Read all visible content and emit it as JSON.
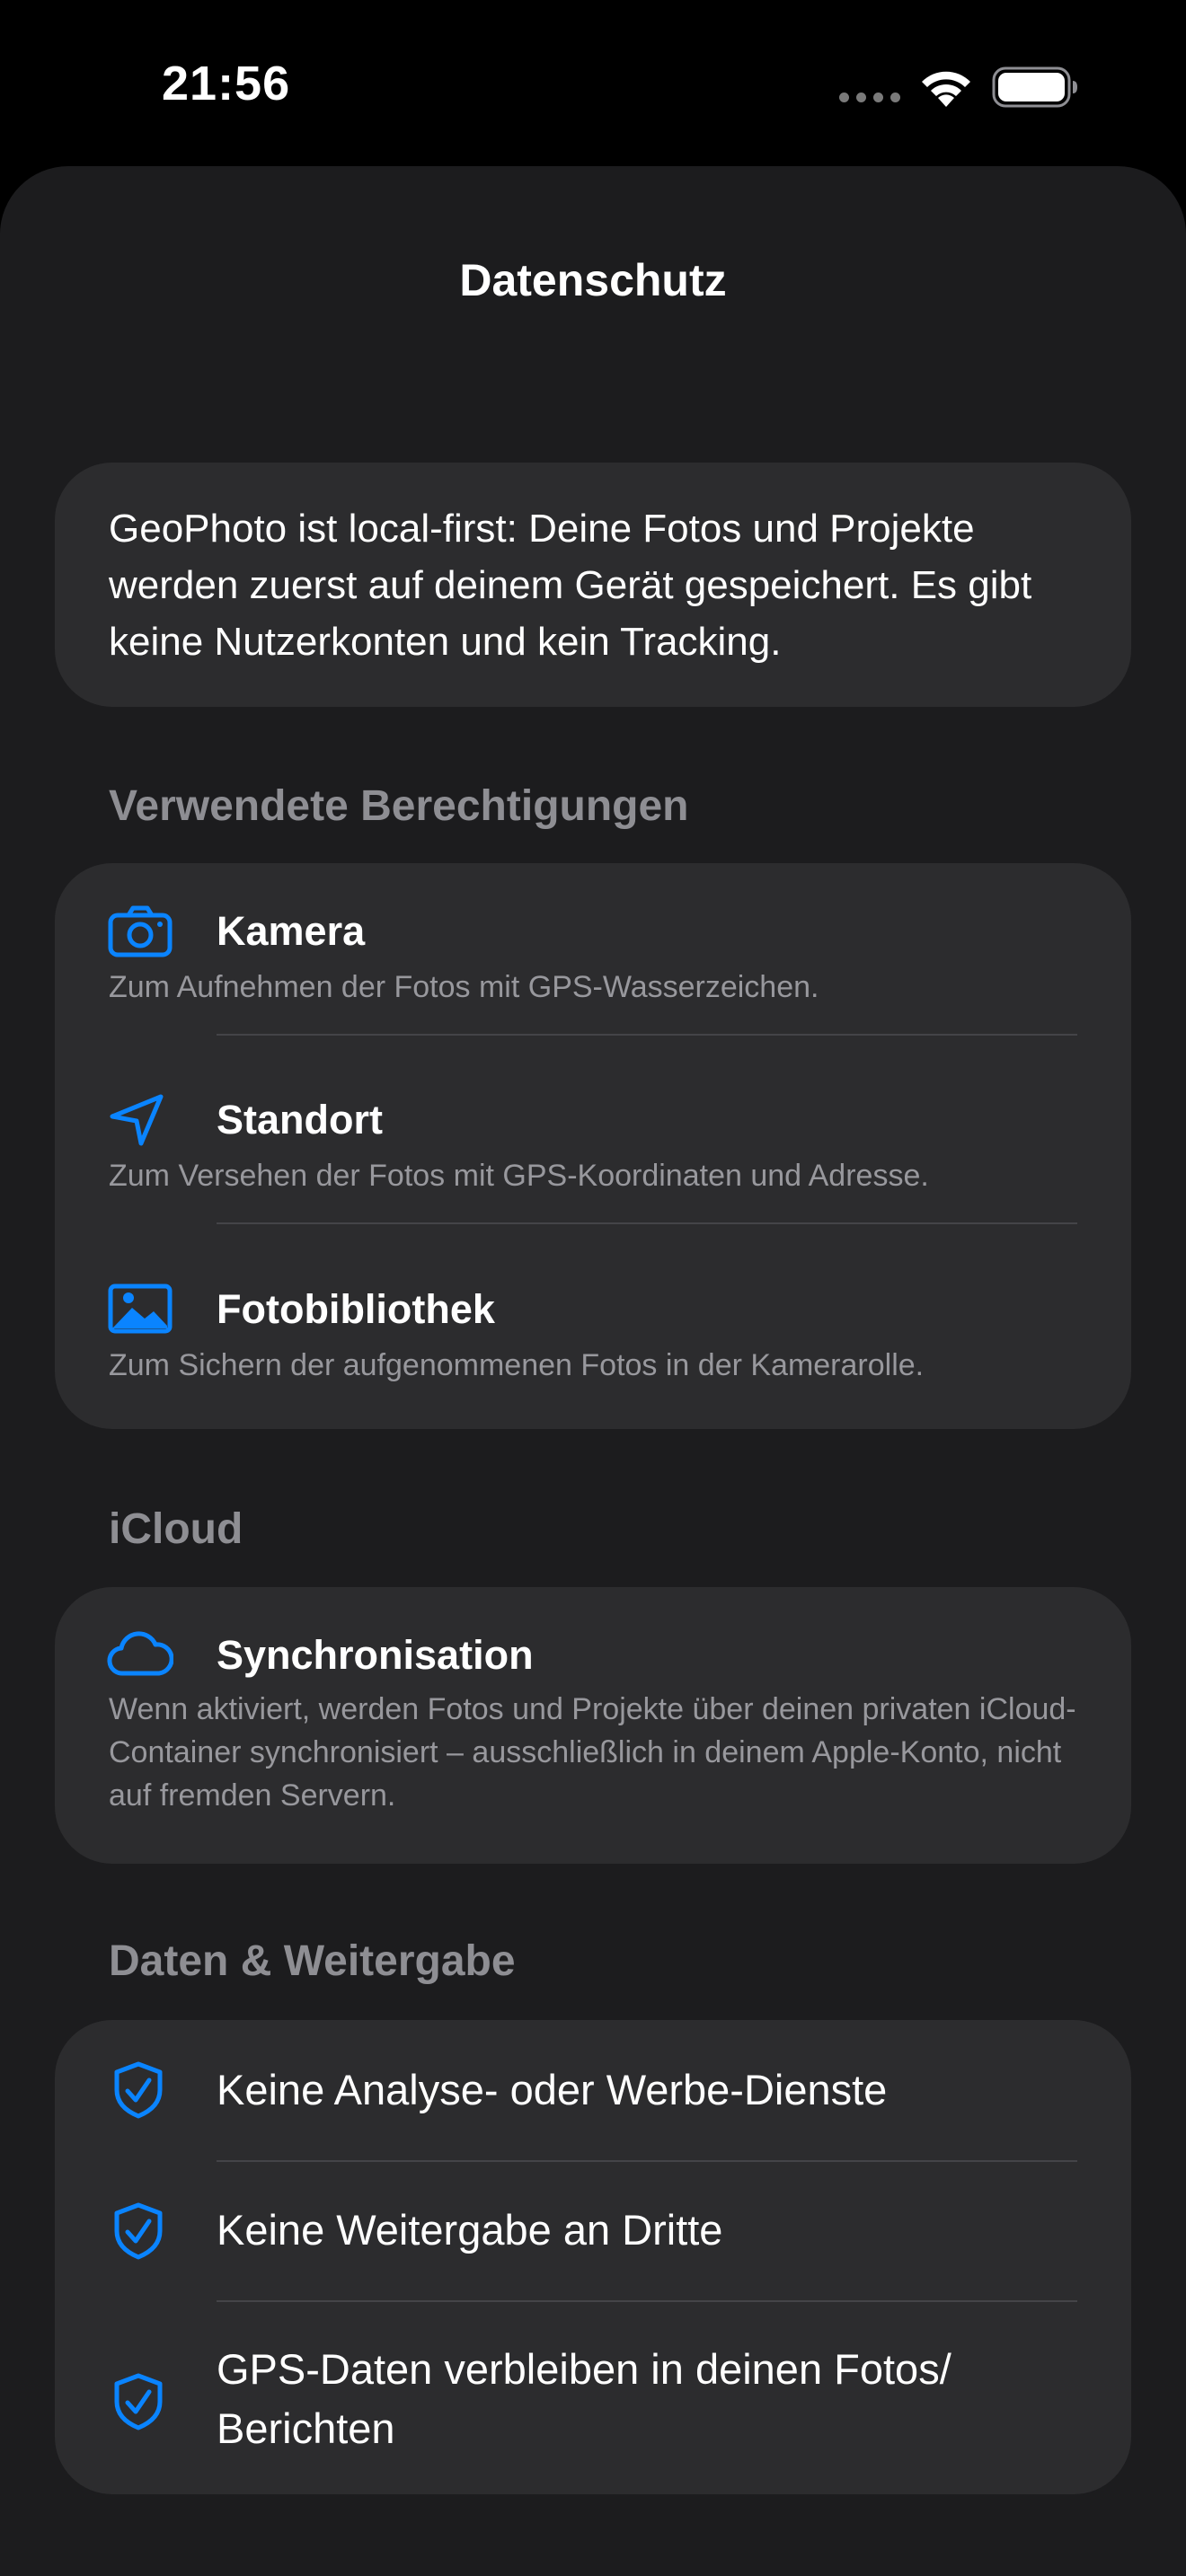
{
  "status_bar": {
    "time": "21:56"
  },
  "sheet": {
    "title": "Datenschutz"
  },
  "intro": {
    "text": "GeoPhoto ist local-first: Deine Fotos und Projekte werden zuerst auf deinem Gerät gespeichert. Es gibt keine Nutzerkonten und kein Tracking."
  },
  "permissions": {
    "header": "Verwendete Berechtigungen",
    "items": [
      {
        "icon": "camera-icon",
        "title": "Kamera",
        "description": "Zum Aufnehmen der Fotos mit GPS-Wasserzeichen."
      },
      {
        "icon": "location-arrow-icon",
        "title": "Standort",
        "description": "Zum Versehen der Fotos mit GPS-Koordinaten und Adresse."
      },
      {
        "icon": "photo-library-icon",
        "title": "Fotobibliothek",
        "description": "Zum Sichern der aufgenommenen Fotos in der Kamerarolle."
      }
    ]
  },
  "icloud": {
    "header": "iCloud",
    "icon": "cloud-icon",
    "title": "Synchronisation",
    "description": "Wenn aktiviert, werden Fotos und Projekte über deinen privaten iCloud-Container synchronisiert – ausschließlich in deinem Apple-Konto, nicht auf fremden Servern."
  },
  "data_sharing": {
    "header": "Daten & Weitergabe",
    "icon": "shield-check-icon",
    "items": [
      {
        "text": "Keine Analyse- oder Werbe-Dienste"
      },
      {
        "text": "Keine Weitergabe an Dritte"
      },
      {
        "text": "GPS-Daten verbleiben in deinen Fotos/ Berichten"
      }
    ]
  },
  "colors": {
    "accent": "#0a84ff",
    "background": "#1c1c1e",
    "card": "#2c2c2e",
    "secondary_text": "#98989d",
    "section_header": "#8e8e93"
  }
}
